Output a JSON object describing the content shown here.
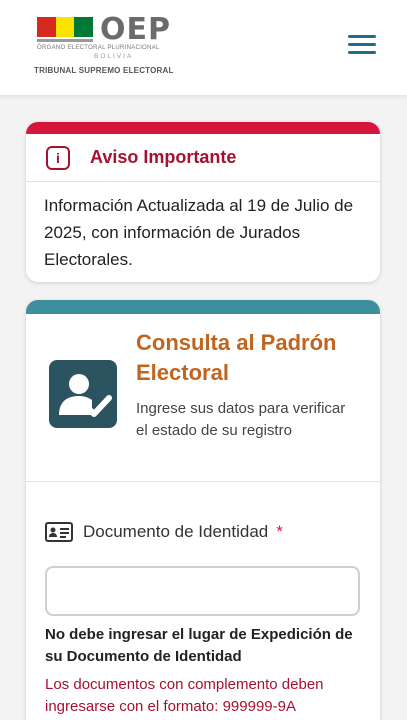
{
  "header": {
    "logo_text": "OEP",
    "logo_sub1": "ÓRGANO ELECTORAL PLURINACIONAL",
    "logo_sub2": "BOLIVIA",
    "logo_sub3": "TRIBUNAL SUPREMO ELECTORAL",
    "flag_colors": [
      "#d52b1e",
      "#f9e300",
      "#007934"
    ],
    "menu_icon": "hamburger-menu-icon"
  },
  "notice": {
    "title": "Aviso Importante",
    "icon": "info-icon",
    "body": "Información Actualizada al 19 de Julio de 2025, con información de Jurados Electorales.",
    "accent_color": "#d6163d"
  },
  "consulta": {
    "title": "Consulta al Padrón Electoral",
    "description": "Ingrese sus datos para verificar el estado de su registro",
    "icon": "user-check-icon",
    "accent_color": "#3c8f9c",
    "field": {
      "label": "Documento de Identidad",
      "required_mark": "*",
      "icon": "id-card-icon",
      "value": "",
      "placeholder": ""
    },
    "note_bold": "No debe ingresar el lugar de Expedición de su Documento de Identidad",
    "note_red": "Los documentos con complemento deben ingresarse con el formato: 999999-9A"
  }
}
